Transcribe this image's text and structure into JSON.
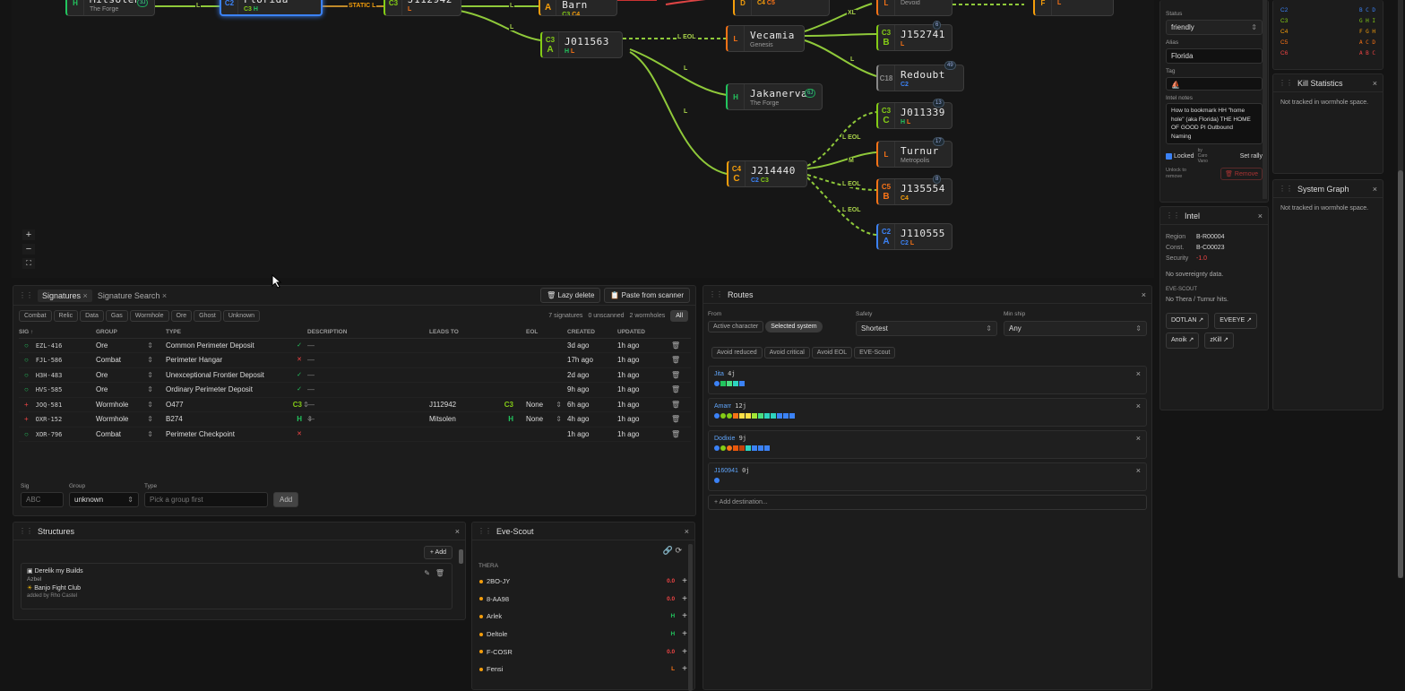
{
  "map": {
    "nodes": [
      {
        "id": "mitsolen",
        "cls1": "H",
        "cls2": "",
        "name": "Mitsolen",
        "sub": "The Forge",
        "subcls": "",
        "color": "#22c55e",
        "badge": "3J"
      },
      {
        "id": "florida",
        "cls1": "C2",
        "cls2": "",
        "name": "Florida",
        "sub": "C3 H",
        "subcls": "",
        "color": "#3b82f6",
        "badge": ""
      },
      {
        "id": "j112942",
        "cls1": "C3",
        "cls2": "",
        "name": "J112942",
        "sub": "L",
        "subcls": "",
        "color": "#84cc16",
        "badge": ""
      },
      {
        "id": "thebarn",
        "cls1": "C4",
        "cls2": "A",
        "name": "The Barn",
        "sub": "C3 C4",
        "subcls": "",
        "color": "#f59e0b",
        "badge": ""
      },
      {
        "id": "nodeD",
        "cls1": "D",
        "cls2": "",
        "name": "",
        "sub": "C4 C5",
        "subcls": "",
        "color": "#f59e0b",
        "badge": ""
      },
      {
        "id": "devoid",
        "cls1": "L",
        "cls2": "",
        "name": "",
        "sub": "Devoid",
        "subcls": "",
        "color": "#f97316",
        "badge": ""
      },
      {
        "id": "nodeF",
        "cls1": "F",
        "cls2": "",
        "name": "",
        "sub": "L",
        "subcls": "",
        "color": "#f59e0b",
        "badge": ""
      },
      {
        "id": "j011563",
        "cls1": "C3",
        "cls2": "A",
        "name": "J011563",
        "sub": "H L",
        "subcls": "",
        "color": "#84cc16",
        "badge": ""
      },
      {
        "id": "vecamia",
        "cls1": "L",
        "cls2": "",
        "name": "Vecamia",
        "sub": "Genesis",
        "subcls": "",
        "color": "#f97316",
        "badge": ""
      },
      {
        "id": "j152741",
        "cls1": "C3",
        "cls2": "B",
        "name": "J152741",
        "sub": "L",
        "subcls": "",
        "color": "#84cc16",
        "badge": "6"
      },
      {
        "id": "redoubt",
        "cls1": "C18",
        "cls2": "",
        "name": "Redoubt",
        "sub": "C2",
        "subcls": "",
        "color": "#888888",
        "badge": "49"
      },
      {
        "id": "jakanerva",
        "cls1": "H",
        "cls2": "",
        "name": "Jakanerva",
        "sub": "The Forge",
        "subcls": "",
        "color": "#22c55e",
        "badge": "6J"
      },
      {
        "id": "j011339",
        "cls1": "C3",
        "cls2": "C",
        "name": "J011339",
        "sub": "H L",
        "subcls": "",
        "color": "#84cc16",
        "badge": "13"
      },
      {
        "id": "turnur",
        "cls1": "L",
        "cls2": "",
        "name": "Turnur",
        "sub": "Metropolis",
        "subcls": "",
        "color": "#f97316",
        "badge": "17"
      },
      {
        "id": "j214440",
        "cls1": "C4",
        "cls2": "C",
        "name": "J214440",
        "sub": "C2 C3",
        "subcls": "",
        "color": "#f59e0b",
        "badge": ""
      },
      {
        "id": "j135554",
        "cls1": "C5",
        "cls2": "B",
        "name": "J135554",
        "sub": "C4",
        "subcls": "",
        "color": "#f97316",
        "badge": "8"
      },
      {
        "id": "j110555",
        "cls1": "C2",
        "cls2": "A",
        "name": "J110555",
        "sub": "C2 L",
        "subcls": "",
        "color": "#3b82f6",
        "badge": ""
      }
    ],
    "edge_labels": [
      "L",
      "STATIC L",
      "L",
      "L",
      "L EOL",
      "XL",
      "L",
      "L",
      "L",
      "L EOL",
      "M",
      "L EOL",
      "L EOL",
      "L EOL"
    ]
  },
  "signatures": {
    "tabs": [
      "Signatures",
      "Signature Search"
    ],
    "lazy_delete": "Lazy delete",
    "paste": "Paste from scanner",
    "filters": [
      "Combat",
      "Relic",
      "Data",
      "Gas",
      "Wormhole",
      "Ore",
      "Ghost",
      "Unknown"
    ],
    "count_sigs": "7 signatures",
    "count_unscanned": "0 unscanned",
    "count_wh": "2 wormholes",
    "all": "All",
    "headers": [
      "SIG ↑",
      "GROUP",
      "TYPE",
      "DESCRIPTION",
      "LEADS TO",
      "EOL",
      "CREATED",
      "UPDATED"
    ],
    "rows": [
      {
        "sig": "EZL-416",
        "group": "Ore",
        "type": "Common Perimeter Deposit",
        "desc": "—",
        "leads": "",
        "leads_cls": "",
        "eol": "",
        "created": "3d ago",
        "updated": "1h ago",
        "wh": false,
        "status": "ok",
        "tcls": ""
      },
      {
        "sig": "FJL-586",
        "group": "Combat",
        "type": "Perimeter Hangar",
        "desc": "—",
        "leads": "",
        "leads_cls": "",
        "eol": "",
        "created": "17h ago",
        "updated": "1h ago",
        "wh": false,
        "status": "bad",
        "tcls": ""
      },
      {
        "sig": "H3H-483",
        "group": "Ore",
        "type": "Unexceptional Frontier Deposit",
        "desc": "—",
        "leads": "",
        "leads_cls": "",
        "eol": "",
        "created": "2d ago",
        "updated": "1h ago",
        "wh": false,
        "status": "ok",
        "tcls": ""
      },
      {
        "sig": "HVS-585",
        "group": "Ore",
        "type": "Ordinary Perimeter Deposit",
        "desc": "—",
        "leads": "",
        "leads_cls": "",
        "eol": "",
        "created": "9h ago",
        "updated": "1h ago",
        "wh": false,
        "status": "ok",
        "tcls": ""
      },
      {
        "sig": "JOQ-581",
        "group": "Wormhole",
        "type": "O477",
        "desc": "—",
        "leads": "J112942",
        "leads_cls": "C3",
        "eol": "None",
        "created": "6h ago",
        "updated": "1h ago",
        "wh": true,
        "status": "",
        "tcls": "C3"
      },
      {
        "sig": "OXR-152",
        "group": "Wormhole",
        "type": "B274",
        "desc": "—",
        "leads": "Mitsolen",
        "leads_cls": "H",
        "eol": "None",
        "created": "4h ago",
        "updated": "1h ago",
        "wh": true,
        "status": "",
        "tcls": "H"
      },
      {
        "sig": "XOR-796",
        "group": "Combat",
        "type": "Perimeter Checkpoint",
        "desc": "",
        "leads": "",
        "leads_cls": "",
        "eol": "",
        "created": "1h ago",
        "updated": "1h ago",
        "wh": false,
        "status": "bad",
        "tcls": ""
      }
    ],
    "form": {
      "sig_label": "Sig",
      "sig_ph": "ABC",
      "group_label": "Group",
      "group_val": "unknown",
      "type_label": "Type",
      "type_ph": "Pick a group first",
      "add": "Add"
    }
  },
  "structures": {
    "title": "Structures",
    "add": "+ Add",
    "name": "Derelik my Builds",
    "type": "Azbel",
    "line": "Banjo Fight Club",
    "added": "added by Rho Castel"
  },
  "evescout": {
    "title": "Eve-Scout",
    "section": "THERA",
    "items": [
      {
        "name": "2BO-JY",
        "cls": "0.0",
        "c": "#ef4444"
      },
      {
        "name": "8-AA98",
        "cls": "0.0",
        "c": "#ef4444"
      },
      {
        "name": "Arlek",
        "cls": "H",
        "c": "#22c55e"
      },
      {
        "name": "Deltole",
        "cls": "H",
        "c": "#22c55e"
      },
      {
        "name": "F-COSR",
        "cls": "0.0",
        "c": "#ef4444"
      },
      {
        "name": "Fensi",
        "cls": "L",
        "c": "#f97316"
      }
    ]
  },
  "routes": {
    "title": "Routes",
    "from": "From",
    "active": "Active character",
    "selected": "Selected system",
    "safety_label": "Safety",
    "safety": "Shortest",
    "minship_label": "Min ship",
    "minship": "Any",
    "avoid": [
      "Avoid reduced",
      "Avoid critical",
      "Avoid EOL",
      "EVE-Scout"
    ],
    "list": [
      {
        "name": "Jita",
        "jumps": "4j",
        "colors": [
          "#3b82f6",
          "#22c55e",
          "#4ade80",
          "#2dd4bf",
          "#3b82f6"
        ]
      },
      {
        "name": "Amarr",
        "jumps": "12j",
        "colors": [
          "#3b82f6",
          "#84cc16",
          "#84cc16",
          "#f97316",
          "#fde047",
          "#fde047",
          "#a3e635",
          "#4ade80",
          "#2dd4bf",
          "#2dd4bf",
          "#3b82f6",
          "#3b82f6",
          "#3b82f6"
        ]
      },
      {
        "name": "Dodixie",
        "jumps": "9j",
        "colors": [
          "#3b82f6",
          "#84cc16",
          "#f97316",
          "#ea580c",
          "#c2410c",
          "#2dd4bf",
          "#3b82f6",
          "#3b82f6",
          "#3b82f6"
        ]
      },
      {
        "name": "J160941",
        "jumps": "0j",
        "colors": [
          "#3b82f6"
        ]
      }
    ],
    "add_dest": "+ Add destination..."
  },
  "sysinfo": {
    "status_label": "Status",
    "status": "friendly",
    "alias_label": "Alias",
    "alias": "Florida",
    "tag_label": "Tag",
    "notes_label": "Intel notes",
    "notes": "How to bookmark HH \"home hole\" (aka Florida) THE HOME OF GOOD PI Outbound Naming",
    "locked": "Locked",
    "by": "by Caro Vano",
    "set_rally": "Set rally",
    "unlock": "Unlock to remove",
    "remove": "Remove"
  },
  "intel": {
    "title": "Intel",
    "region_l": "Region",
    "region": "B-R00004",
    "const_l": "Const.",
    "const": "B-C00023",
    "sec_l": "Security",
    "sec": "-1.0",
    "sov": "No sovereignty data.",
    "scout_l": "EVE-SCOUT",
    "scout": "No Thera / Turnur hits.",
    "links": [
      "DOTLAN",
      "EVEEYE",
      "Anoik",
      "zKill"
    ]
  },
  "effects": {
    "rows": [
      [
        "C2",
        "#3b82f6",
        "B C D"
      ],
      [
        "C3",
        "#84cc16",
        "G H I"
      ],
      [
        "C4",
        "#f59e0b",
        "F G H"
      ],
      [
        "C5",
        "#f97316",
        "A C D"
      ],
      [
        "C6",
        "#ef4444",
        "A B C"
      ]
    ]
  },
  "kill": {
    "title": "Kill Statistics",
    "text": "Not tracked in wormhole space."
  },
  "sysgraph": {
    "title": "System Graph",
    "text": "Not tracked in wormhole space."
  }
}
